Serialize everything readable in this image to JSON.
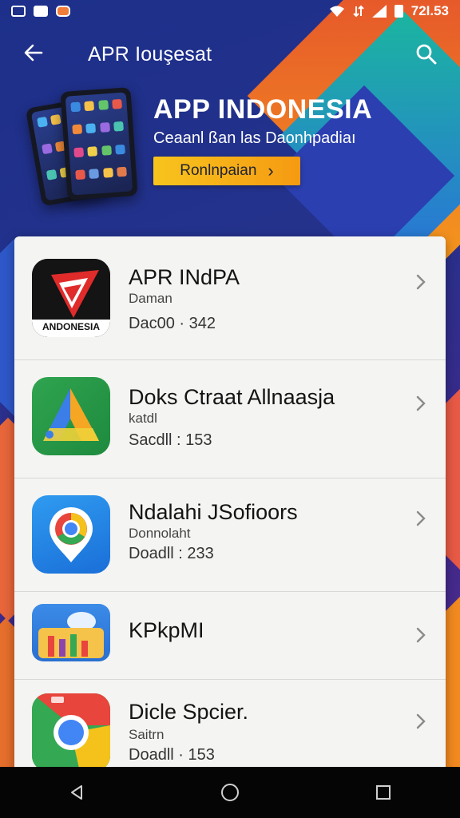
{
  "status_bar": {
    "time": "72I.53"
  },
  "header": {
    "title": "APR Iouşesat"
  },
  "banner": {
    "title": "APP INDONESIA",
    "subtitle": "Ceaanl ßan las Daonhpadiaı",
    "button_label": "Ronlnpaian"
  },
  "apps": [
    {
      "name": "APR INdPA",
      "category": "Daman",
      "meta": "Dac00 · 342",
      "icon_text": "ANDONESIA"
    },
    {
      "name": "Doks Ctraat Allnaasja",
      "category": "katdl",
      "meta": "Sacdll : 153"
    },
    {
      "name": "Ndalahi JSofioors",
      "category": "Donnolaht",
      "meta": "Doadll : 233"
    },
    {
      "name": "KPkpMI"
    },
    {
      "name": "Dicle Spcier.",
      "category": "Saitrn",
      "meta": "Doadll · 153"
    }
  ],
  "colors": {
    "banner_button": "#f8c41d",
    "card_bg": "#f4f4f2"
  },
  "icons": [
    "back-arrow-icon",
    "search-icon",
    "chevron-right-icon",
    "nav-back-icon",
    "nav-home-icon",
    "nav-recents-icon"
  ]
}
